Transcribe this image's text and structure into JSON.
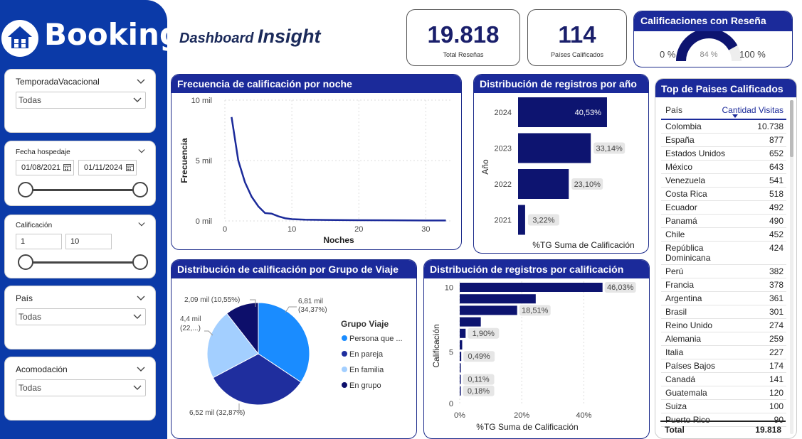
{
  "brand": {
    "name": "Booking"
  },
  "header": {
    "title_part1": "Dashboard ",
    "title_part2": "Insight"
  },
  "kpis": {
    "total_reviews": {
      "value": "19.818",
      "label": "Total Reseñas"
    },
    "countries": {
      "value": "114",
      "label": "Países Calificados"
    }
  },
  "gauge": {
    "title": "Calificaciones con Reseña",
    "min_label": "0 %",
    "value_label": "84 %",
    "max_label": "100 %",
    "value_fraction": 0.84,
    "fill_color": "#0d1470",
    "track_color": "#eeeeee"
  },
  "filters": {
    "season": {
      "title": "TemporadaVacacional",
      "value": "Todas"
    },
    "date": {
      "title": "Fecha hospedaje",
      "start": "01/08/2021",
      "end": "01/11/2024"
    },
    "rating": {
      "title": "Calificación",
      "min": "1",
      "max": "10"
    },
    "country": {
      "title": "País",
      "value": "Todas"
    },
    "lodging": {
      "title": "Acomodación",
      "value": "Todas"
    }
  },
  "panels": {
    "nights": "Frecuencia de calificación por noche",
    "year": "Distribución de registros por año",
    "group": "Distribución de calificación por Grupo de Viaje",
    "rating": "Distribución de registros por calificación",
    "top": "Top de Paises Calificados"
  },
  "colors": {
    "brand_blue": "#0b3aa8",
    "panel_header": "#1b2a9a",
    "bar": "#0d1470",
    "pie": [
      "#1a8cff",
      "#1f2e9e",
      "#a3cfff",
      "#0d0f6b"
    ]
  },
  "chart_data": [
    {
      "type": "line",
      "xlabel": "Noches",
      "ylabel": "Frecuencia",
      "x": [
        1,
        2,
        3,
        4,
        5,
        6,
        7,
        8,
        9,
        10,
        12,
        15,
        20,
        25,
        30,
        33
      ],
      "y": [
        8600,
        5000,
        3200,
        2000,
        1200,
        650,
        600,
        380,
        220,
        150,
        100,
        80,
        60,
        50,
        40,
        40
      ],
      "ylim": [
        0,
        10000
      ],
      "xlim": [
        0,
        34
      ],
      "yticks": [
        "0 mil",
        "5 mil",
        "10 mil"
      ],
      "xticks": [
        "0",
        "10",
        "20",
        "30"
      ],
      "grid": true
    },
    {
      "type": "bar",
      "orientation": "horizontal",
      "ylabel": "Año",
      "xlabel": "%TG Suma de Calificación",
      "categories": [
        "2024",
        "2023",
        "2022",
        "2021"
      ],
      "values": [
        40.53,
        33.14,
        23.1,
        3.22
      ],
      "labels": [
        "40,53%",
        "33,14%",
        "23,10%",
        "3,22%"
      ],
      "xlim": [
        0,
        60
      ]
    },
    {
      "type": "pie",
      "legend_title": "Grupo Viaje",
      "legend_position": "right",
      "slices": [
        {
          "name": "Persona que ...",
          "value": 34.37,
          "label1": "6,81 mil",
          "label2": "(34,37%)"
        },
        {
          "name": "En pareja",
          "value": 32.87,
          "label1": "6,52 mil (32,87%)",
          "label2": ""
        },
        {
          "name": "En familia",
          "value": 22.21,
          "label1": "4,4 mil",
          "label2": "(22,...)"
        },
        {
          "name": "En grupo",
          "value": 10.55,
          "label1": "2,09 mil (10,55%)",
          "label2": ""
        }
      ]
    },
    {
      "type": "bar",
      "orientation": "horizontal",
      "ylabel": "Calificación",
      "xlabel": "%TG Suma de Calificación",
      "categories": [
        "10",
        "9",
        "8",
        "7",
        "6",
        "5",
        "4",
        "3",
        "2",
        "1"
      ],
      "values": [
        46.03,
        24.5,
        18.51,
        6.8,
        1.9,
        0.8,
        0.49,
        0.3,
        0.11,
        0.18
      ],
      "labels": [
        "46,03%",
        "",
        "18,51%",
        "",
        "1,90%",
        "",
        "0,49%",
        "",
        "0,11%",
        "0,18%"
      ],
      "xlim": [
        0,
        50
      ],
      "xticks": [
        "0%",
        "20%",
        "40%"
      ],
      "yticks": [
        "0",
        "5",
        "10"
      ]
    }
  ],
  "top_table": {
    "col_country": "País",
    "col_visits": "Cantidad Visitas",
    "rows": [
      {
        "name": "Colombia",
        "value": "10.738"
      },
      {
        "name": "España",
        "value": "877"
      },
      {
        "name": "Estados Unidos",
        "value": "652"
      },
      {
        "name": "México",
        "value": "643"
      },
      {
        "name": "Venezuela",
        "value": "541"
      },
      {
        "name": "Costa Rica",
        "value": "518"
      },
      {
        "name": "Ecuador",
        "value": "492"
      },
      {
        "name": "Panamá",
        "value": "490"
      },
      {
        "name": "Chile",
        "value": "452"
      },
      {
        "name": "República Dominicana",
        "value": "424"
      },
      {
        "name": "Perú",
        "value": "382"
      },
      {
        "name": "Francia",
        "value": "378"
      },
      {
        "name": "Argentina",
        "value": "361"
      },
      {
        "name": "Brasil",
        "value": "301"
      },
      {
        "name": "Reino Unido",
        "value": "274"
      },
      {
        "name": "Alemania",
        "value": "259"
      },
      {
        "name": "Italia",
        "value": "227"
      },
      {
        "name": "Países Bajos",
        "value": "174"
      },
      {
        "name": "Canadá",
        "value": "141"
      },
      {
        "name": "Guatemala",
        "value": "120"
      },
      {
        "name": "Suiza",
        "value": "100"
      },
      {
        "name": "Puerto Rico",
        "value": "90"
      }
    ],
    "total_label": "Total",
    "total_value": "19.818"
  }
}
